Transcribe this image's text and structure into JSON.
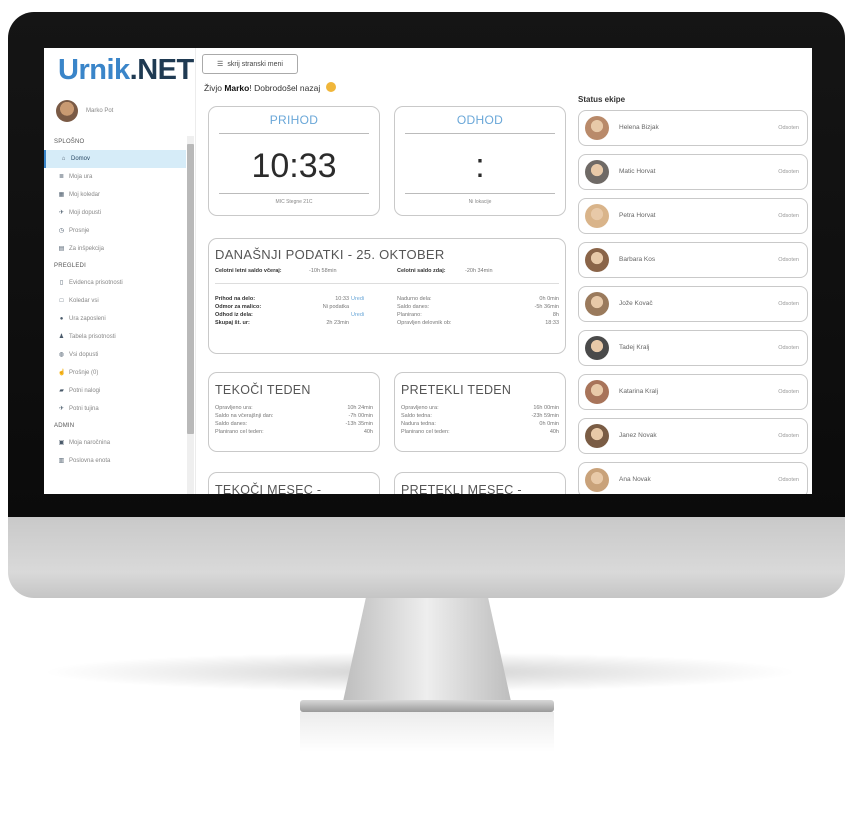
{
  "app": {
    "logo_part1": "Urnik",
    "logo_part2": ".NET"
  },
  "profile": {
    "name": "Marko Pot"
  },
  "sidebar": {
    "sections": [
      {
        "title": "SPLOŠNO",
        "items": [
          {
            "label": "Domov",
            "icon": "home-icon",
            "active": true
          },
          {
            "label": "Moja ura",
            "icon": "list-icon"
          },
          {
            "label": "Moj koledar",
            "icon": "calendar-icon"
          },
          {
            "label": "Moji dopusti",
            "icon": "plane-icon"
          },
          {
            "label": "Prosnje",
            "icon": "clock-icon"
          },
          {
            "label": "Za inšpekcija",
            "icon": "table-icon"
          }
        ]
      },
      {
        "title": "PREGLEDI",
        "items": [
          {
            "label": "Evidenca prisotnosti",
            "icon": "clipboard-icon"
          },
          {
            "label": "Koledar vsi",
            "icon": "calendar-outline-icon"
          },
          {
            "label": "Ura zaposleni",
            "icon": "drop-icon"
          },
          {
            "label": "Tabela prisotnosti",
            "icon": "users-icon"
          },
          {
            "label": "Vsi dopusti",
            "icon": "globe-icon"
          },
          {
            "label": "Prošnje (0)",
            "icon": "thumb-icon"
          },
          {
            "label": "Potni nalogi",
            "icon": "car-icon"
          },
          {
            "label": "Potni tujina",
            "icon": "plane-icon"
          }
        ]
      },
      {
        "title": "ADMIN",
        "items": [
          {
            "label": "Moja naročnina",
            "icon": "card-icon"
          },
          {
            "label": "Poslovna enota",
            "icon": "building-icon"
          }
        ]
      }
    ]
  },
  "toolbar": {
    "toggle_label": "skrij stranski meni"
  },
  "greeting": {
    "prefix": "Živjo ",
    "name": "Marko",
    "suffix": "! Dobrodošel nazaj"
  },
  "clock_in": {
    "title": "PRIHOD",
    "time": "10:33",
    "location": "MIC Stegne 21C"
  },
  "clock_out": {
    "title": "ODHOD",
    "time": ":",
    "location": "Ni lokacije"
  },
  "today": {
    "title": "DANAŠNJI PODATKI - 25. OKTOBER",
    "saldo_prev_label": "Celotni letni saldo včeraj:",
    "saldo_prev_value": "-10h 58min",
    "saldo_now_label": "Celotni saldo zdaj:",
    "saldo_now_value": "-20h 34min",
    "left_rows": [
      {
        "label": "Prihod na delo:",
        "value": "10:33",
        "extra": "Uredi"
      },
      {
        "label": "Odmor za malico:",
        "value": "Ni podatka",
        "extra": ""
      },
      {
        "label": "Odhod iz dela:",
        "value": "",
        "extra": "Uredi"
      },
      {
        "label": "Skupaj št. ur:",
        "value": "2h 23min",
        "extra": ""
      }
    ],
    "right_rows": [
      {
        "label": "Nadurno dela:",
        "value": "0h 0min"
      },
      {
        "label": "Saldo danes:",
        "value": "-5h 36min"
      },
      {
        "label": "Planirano:",
        "value": "8h"
      },
      {
        "label": "Opravljen delovnik ob:",
        "value": "18:33"
      }
    ]
  },
  "current_week": {
    "title": "TEKOČI TEDEN",
    "rows": [
      {
        "label": "Opravljeno ura:",
        "value": "10h 24min"
      },
      {
        "label": "Saldo na včerajšnji dan:",
        "value": "-7h 00min"
      },
      {
        "label": "Saldo danes:",
        "value": "-13h 35min"
      },
      {
        "label": "Planirano cel teden:",
        "value": "40h"
      }
    ]
  },
  "last_week": {
    "title": "PRETEKLI TEDEN",
    "rows": [
      {
        "label": "Opravljeno ura:",
        "value": "16h 00min"
      },
      {
        "label": "Saldo tedna:",
        "value": "-23h 59min"
      },
      {
        "label": "Nadura tedna:",
        "value": "0h 0min"
      },
      {
        "label": "Planirano cel teden:",
        "value": "40h"
      }
    ]
  },
  "current_month": {
    "title": "TEKOČI MESEC -"
  },
  "last_month": {
    "title": "PRETEKLI MESEC -"
  },
  "team": {
    "title": "Status ekipe",
    "members": [
      {
        "name": "Helena Bizjak",
        "status": "Odsoten",
        "color": "#b98a6a"
      },
      {
        "name": "Matic Horvat",
        "status": "Odsoten",
        "color": "#6f6a66"
      },
      {
        "name": "Petra Horvat",
        "status": "Odsoten",
        "color": "#d9b48a"
      },
      {
        "name": "Barbara Kos",
        "status": "Odsoten",
        "color": "#8a6448"
      },
      {
        "name": "Jože Kovač",
        "status": "Odsoten",
        "color": "#9a7a5c"
      },
      {
        "name": "Tadej Kralj",
        "status": "Odsoten",
        "color": "#4a4a4a"
      },
      {
        "name": "Katarina Kralj",
        "status": "Odsoten",
        "color": "#a8745a"
      },
      {
        "name": "Janez Novak",
        "status": "Odsoten",
        "color": "#7a5c44"
      },
      {
        "name": "Ana Novak",
        "status": "Odsoten",
        "color": "#c9a27a"
      }
    ]
  }
}
